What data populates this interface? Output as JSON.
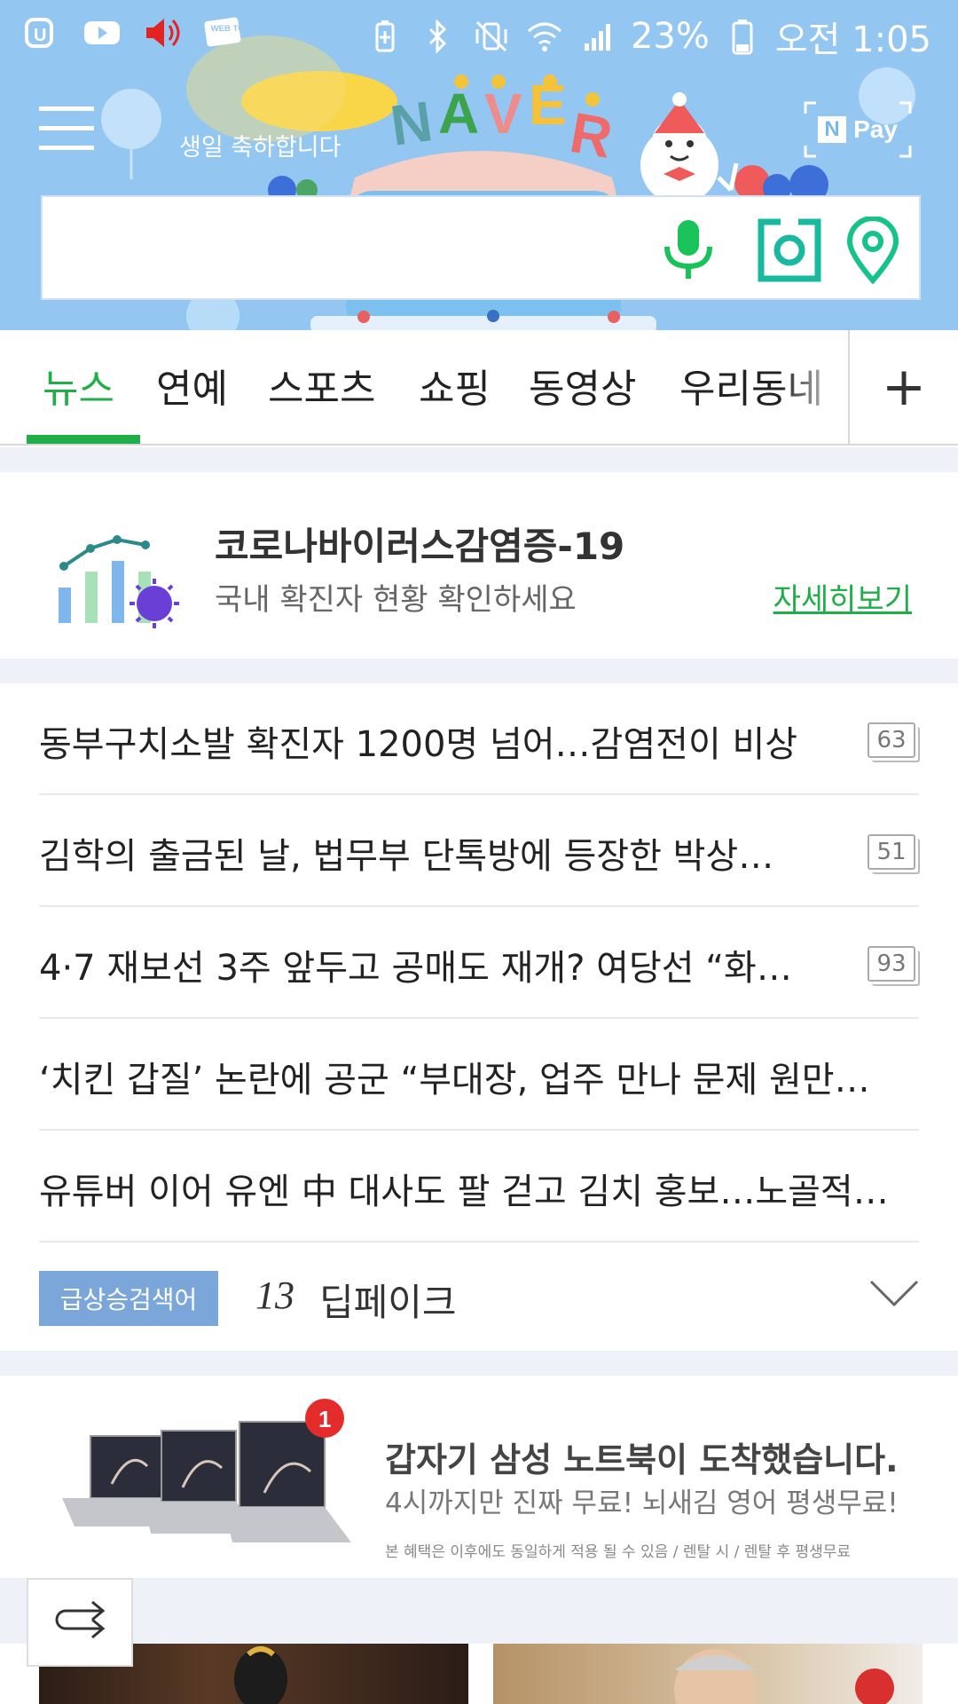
{
  "status_bar": {
    "battery": "23%",
    "time": "오전 1:05",
    "left_icons": [
      "naver-app-icon",
      "youtube-icon",
      "volume-icon",
      "webtoon-icon"
    ],
    "webtoon_label": "WEB TOON",
    "right_icons": [
      "battery-saver-icon",
      "bluetooth-icon",
      "vibrate-icon",
      "wifi-icon",
      "signal-icon",
      "battery-icon"
    ]
  },
  "header": {
    "logo": "NAVER",
    "birthday_text": "생일 축하합니다",
    "npay_label": "Pay",
    "npay_n": "N",
    "search": {
      "placeholder": "",
      "icons": [
        "mic-icon",
        "camera-search-icon",
        "location-icon"
      ]
    }
  },
  "tabs": {
    "items": [
      "뉴스",
      "연예",
      "스포츠",
      "쇼핑",
      "동영상",
      "우리동네"
    ],
    "active": "뉴스",
    "add_label": "+"
  },
  "covid": {
    "title": "코로나바이러스감염증-19",
    "subtitle": "국내 확진자 현황 확인하세요",
    "more": "자세히보기"
  },
  "news": {
    "items": [
      {
        "title": "동부구치소발 확진자 1200명 넘어…감염전이 비상",
        "count": "63"
      },
      {
        "title": "김학의 출금된 날, 법무부 단톡방에 등장한 박상…",
        "count": "51"
      },
      {
        "title": "4·7 재보선 3주 앞두고 공매도 재개? 여당선 “화…",
        "count": "93"
      },
      {
        "title": "‘치킨 갑질’ 논란에 공군 “부대장, 업주 만나 문제 원만…",
        "count": ""
      },
      {
        "title": "유튜버 이어 유엔 中 대사도 팔 걷고 김치 홍보…노골적…",
        "count": ""
      }
    ],
    "trending": {
      "badge": "급상승검색어",
      "rank": "13",
      "keyword": "딥페이크"
    }
  },
  "ad": {
    "badge": "1",
    "title": "갑자기 삼성 노트북이 도착했습니다.",
    "subtitle": "4시까지만 진짜 무료! 뇌새김 영어 평생무료!",
    "note": "본 혜택은 이후에도 동일하게 적용 될 수 있음 / 렌탈 시 / 렌탈 후 평생무료"
  },
  "colors": {
    "header_bg": "#93c6f1",
    "accent_green": "#1fae48",
    "search_icon_green": "#19c35a",
    "trend_badge": "#7aa6da"
  }
}
